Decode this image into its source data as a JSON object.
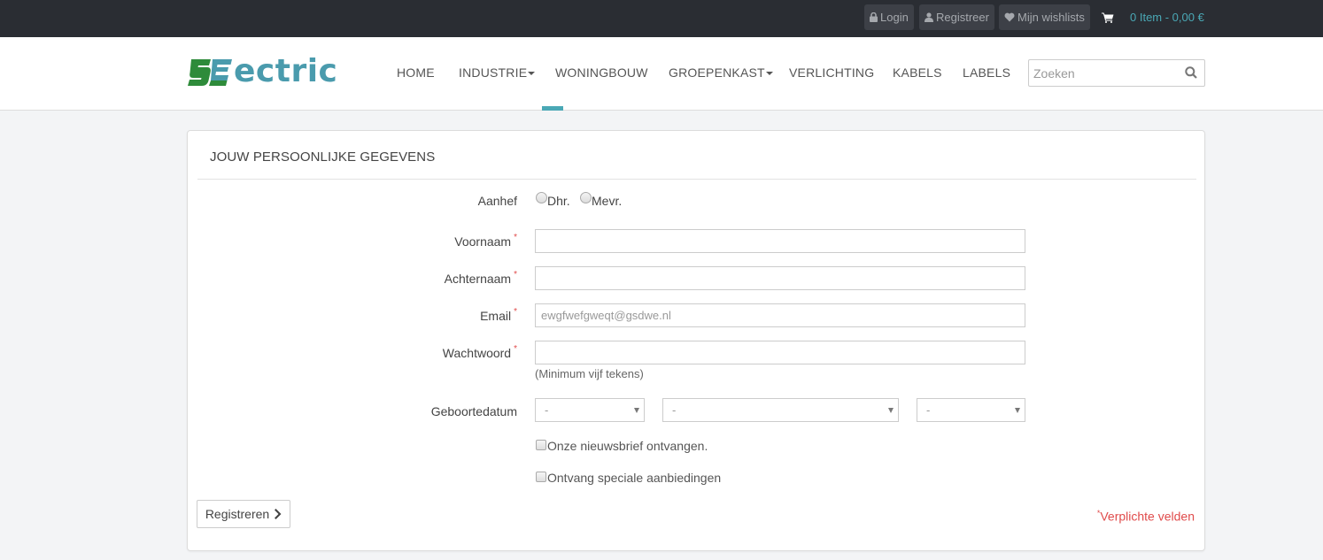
{
  "topbar": {
    "login_label": "Login",
    "register_label": "Registreer",
    "wishlist_label": "Mijn wishlists",
    "cart_text": "0 Item - 0,00 €"
  },
  "brand": {
    "logo_mark": "S",
    "logo_text": "ectric",
    "logo_colors": {
      "mark": "#2e8b3a",
      "text": "#4a9bad"
    }
  },
  "nav": {
    "items": [
      {
        "label": "HOME",
        "dropdown": false
      },
      {
        "label": "INDUSTRIE",
        "dropdown": true
      },
      {
        "label": "WONINGBOUW",
        "dropdown": false,
        "active": true
      },
      {
        "label": "GROEPENKAST",
        "dropdown": true
      },
      {
        "label": "VERLICHTING",
        "dropdown": false
      },
      {
        "label": "KABELS",
        "dropdown": false
      },
      {
        "label": "LABELS",
        "dropdown": false
      }
    ],
    "search_placeholder": "Zoeken"
  },
  "form": {
    "title": "JOUW PERSOONLIJKE GEGEVENS",
    "salutation": {
      "label": "Aanhef",
      "options": [
        "Dhr.",
        "Mevr."
      ]
    },
    "first_name": {
      "label": "Voornaam",
      "required_mark": "*",
      "value": ""
    },
    "last_name": {
      "label": "Achternaam",
      "required_mark": "*",
      "value": ""
    },
    "email": {
      "label": "Email",
      "required_mark": "*",
      "value": "ewgfwefgweqt@gsdwe.nl"
    },
    "password": {
      "label": "Wachtwoord",
      "required_mark": "*",
      "value": "",
      "hint": "(Minimum vijf tekens)"
    },
    "birthdate": {
      "label": "Geboortedatum",
      "day": "-",
      "month": "-",
      "year": "-"
    },
    "newsletter_label": "Onze nieuwsbrief ontvangen.",
    "offers_label": "Ontvang speciale aanbiedingen",
    "submit_label": "Registreren",
    "required_note_mark": "*",
    "required_note": "Verplichte velden"
  },
  "colors": {
    "accent": "#4aa8b5",
    "topbar_bg": "#2a2d33",
    "required": "#e04b4b"
  }
}
